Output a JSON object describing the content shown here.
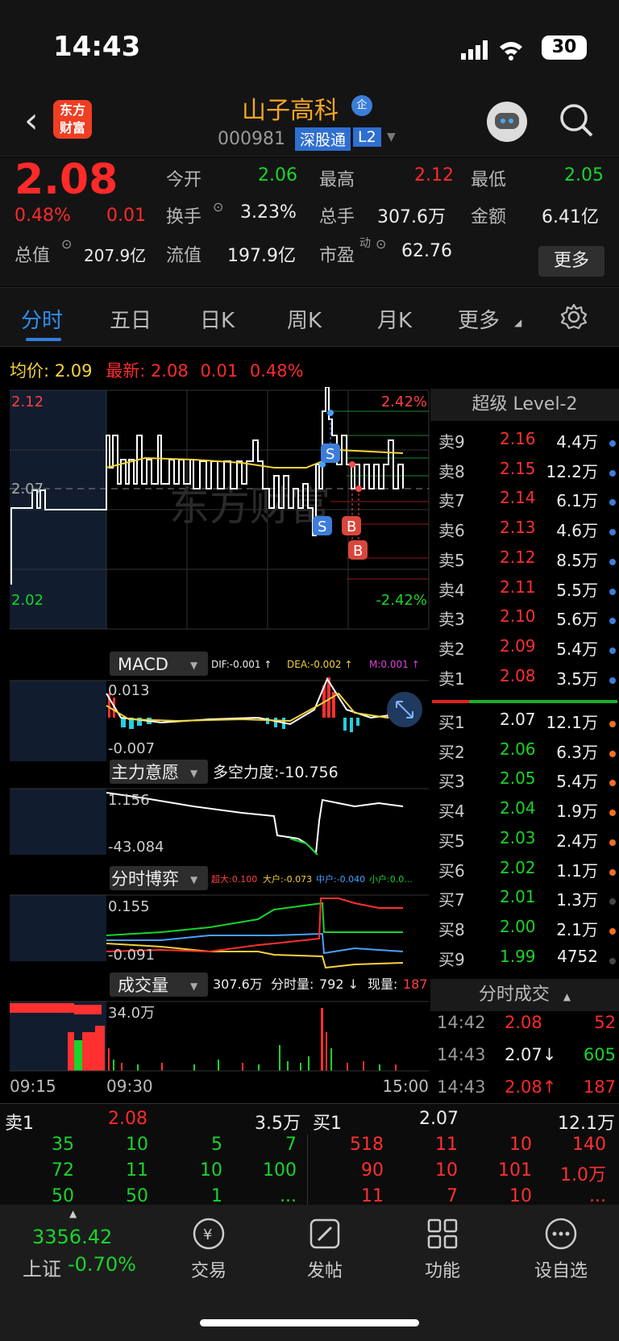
{
  "status_bar": {
    "time": "14:43",
    "battery": "30"
  },
  "header": {
    "logo_line1": "东方",
    "logo_line2": "财富",
    "stock_name": "山子高科",
    "stock_badge": "企",
    "stock_code": "000981",
    "tag_market": "深股通",
    "tag_level": "L2"
  },
  "quote": {
    "price": "2.08",
    "change_pct": "0.48%",
    "change": "0.01",
    "open_label": "今开",
    "open": "2.06",
    "high_label": "最高",
    "high": "2.12",
    "low_label": "最低",
    "low": "2.05",
    "turnover_label": "换手",
    "turnover": "3.23%",
    "volume_label": "总手",
    "volume": "307.6万",
    "amount_label": "金额",
    "amount": "6.41亿",
    "mktcap_label": "总值",
    "mktcap": "207.9亿",
    "float_label": "流值",
    "float_cap": "197.9亿",
    "pe_label": "市盈",
    "pe_sup": "动",
    "pe": "62.76",
    "more_label": "更多"
  },
  "tabs": [
    "分时",
    "五日",
    "日K",
    "周K",
    "月K",
    "更多"
  ],
  "intraday": {
    "avg_label": "均价:",
    "avg": "2.09",
    "latest_label": "最新:",
    "latest": "2.08",
    "latest_change": "0.01",
    "latest_pct": "0.48%",
    "y_high": "2.12",
    "y_mid": "2.07",
    "y_low": "2.02",
    "pct_high": "2.42%",
    "pct_low": "-2.42%",
    "watermark": "东方财富",
    "markers": [
      "S",
      "S",
      "B",
      "B"
    ]
  },
  "macd": {
    "name": "MACD",
    "dif": "DIF:-0.001 ↑",
    "dea": "DEA:-0.002 ↑",
    "m": "M:0.001 ↑",
    "y_top": "0.013",
    "y_bottom": "-0.007"
  },
  "main_force": {
    "name": "主力意愿",
    "force": "多空力度:-10.756",
    "y_top": "1.156",
    "y_bottom": "-43.084"
  },
  "game": {
    "name": "分时博弈",
    "big": "超大:0.100",
    "large": "大户:-0.073",
    "mid": "中户:-0.040",
    "small": "小户:0.0...",
    "y_top": "0.155",
    "y_bottom": "-0.091"
  },
  "volume_panel": {
    "name": "成交量",
    "total": "307.6万",
    "tick_label": "分时量:",
    "tick": "792 ↓",
    "now_label": "现量:",
    "now": "187",
    "y_top": "34.0万",
    "t_start": "09:15",
    "t_open": "09:30",
    "t_close": "15:00"
  },
  "level2": {
    "title": "超级 Level-2",
    "asks": [
      {
        "label": "卖9",
        "price": "2.16",
        "vol": "4.4万"
      },
      {
        "label": "卖8",
        "price": "2.15",
        "vol": "12.2万"
      },
      {
        "label": "卖7",
        "price": "2.14",
        "vol": "6.1万"
      },
      {
        "label": "卖6",
        "price": "2.13",
        "vol": "4.6万"
      },
      {
        "label": "卖5",
        "price": "2.12",
        "vol": "8.5万"
      },
      {
        "label": "卖4",
        "price": "2.11",
        "vol": "5.5万"
      },
      {
        "label": "卖3",
        "price": "2.10",
        "vol": "5.6万"
      },
      {
        "label": "卖2",
        "price": "2.09",
        "vol": "5.4万"
      },
      {
        "label": "卖1",
        "price": "2.08",
        "vol": "3.5万"
      }
    ],
    "bids": [
      {
        "label": "买1",
        "price": "2.07",
        "vol": "12.1万"
      },
      {
        "label": "买2",
        "price": "2.06",
        "vol": "6.3万"
      },
      {
        "label": "买3",
        "price": "2.05",
        "vol": "5.4万"
      },
      {
        "label": "买4",
        "price": "2.04",
        "vol": "1.9万"
      },
      {
        "label": "买5",
        "price": "2.03",
        "vol": "2.4万"
      },
      {
        "label": "买6",
        "price": "2.02",
        "vol": "1.1万"
      },
      {
        "label": "买7",
        "price": "2.01",
        "vol": "1.3万"
      },
      {
        "label": "买8",
        "price": "2.00",
        "vol": "2.1万"
      },
      {
        "label": "买9",
        "price": "1.99",
        "vol": "4752"
      }
    ],
    "ticks_title": "分时成交",
    "ticks": [
      {
        "time": "14:42",
        "price": "2.08",
        "vol": "52"
      },
      {
        "time": "14:43",
        "price": "2.07↓",
        "vol": "605"
      },
      {
        "time": "14:43",
        "price": "2.08↑",
        "vol": "187"
      }
    ]
  },
  "queue": {
    "sell_label": "卖1",
    "sell_price": "2.08",
    "sell_vol": "3.5万",
    "buy_label": "买1",
    "buy_price": "2.07",
    "buy_vol": "12.1万",
    "sell_rows": [
      [
        "35",
        "10",
        "5",
        "7"
      ],
      [
        "72",
        "11",
        "10",
        "100"
      ],
      [
        "50",
        "50",
        "1",
        "..."
      ]
    ],
    "buy_rows": [
      [
        "518",
        "11",
        "10",
        "140"
      ],
      [
        "90",
        "10",
        "101",
        "1.0万"
      ],
      [
        "11",
        "7",
        "10",
        "..."
      ]
    ]
  },
  "nav": {
    "index_value": "3356.42",
    "index_name": "上证",
    "index_pct": "-0.70%",
    "items": [
      "交易",
      "发帖",
      "功能",
      "设自选"
    ]
  }
}
